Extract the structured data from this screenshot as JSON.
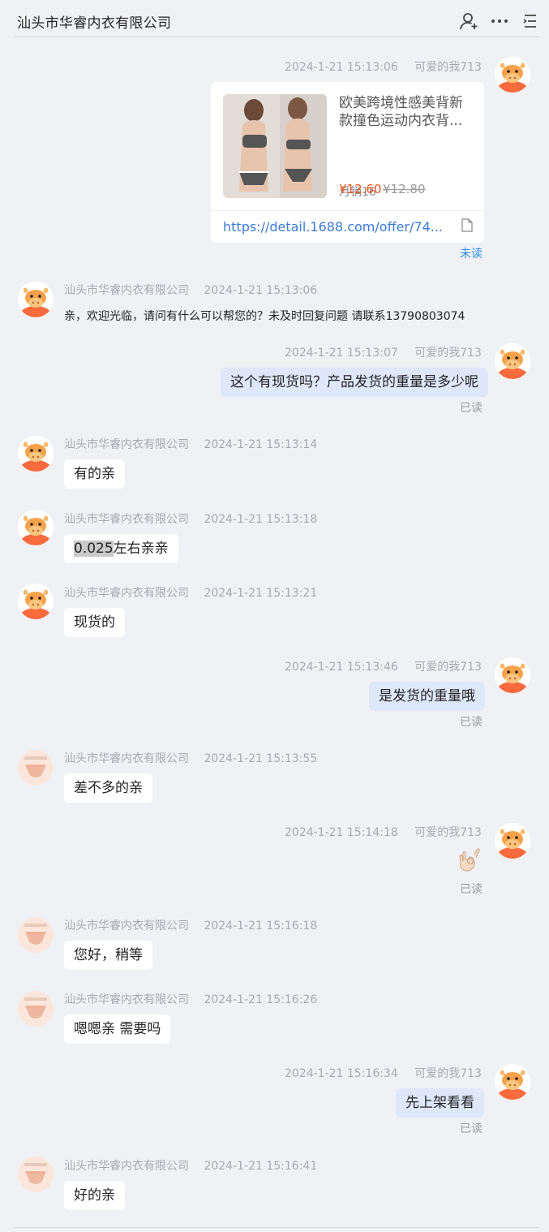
{
  "header": {
    "title": "汕头市华睿内衣有限公司",
    "icons": [
      "add-contact-icon",
      "more-icon",
      "menu-icon"
    ]
  },
  "messages": [
    {
      "side": "right",
      "sender": "可爱的我713",
      "time": "2024-1-21 15:13:06",
      "type": "product-card",
      "product": {
        "title": "欧美跨境性感美背新款撞色运动内衣背...",
        "sales": "月销16",
        "price": "¥12.60",
        "old_price": "¥12.80",
        "link": "https://detail.1688.com/offer/74..."
      },
      "status": "未读"
    },
    {
      "side": "left",
      "sender": "汕头市华睿内衣有限公司",
      "time": "2024-1-21 15:13:06",
      "text": "亲，欢迎光临，请问有什么可以帮您的？未及时回复问题 请联系13790803074"
    },
    {
      "side": "right",
      "sender": "可爱的我713",
      "time": "2024-1-21 15:13:07",
      "text": "这个有现货吗？产品发货的重量是多少呢",
      "status": "已读"
    },
    {
      "side": "left",
      "sender": "汕头市华睿内衣有限公司",
      "time": "2024-1-21 15:13:14",
      "text": "有的亲"
    },
    {
      "side": "left",
      "sender": "汕头市华睿内衣有限公司",
      "time": "2024-1-21 15:13:18",
      "text_highlight": "0.025",
      "text": "左右亲亲"
    },
    {
      "side": "left",
      "sender": "汕头市华睿内衣有限公司",
      "time": "2024-1-21 15:13:21",
      "text": "现货的"
    },
    {
      "side": "right",
      "sender": "可爱的我713",
      "time": "2024-1-21 15:13:46",
      "text": "是发货的重量哦",
      "status": "已读"
    },
    {
      "side": "left",
      "sender": "汕头市华睿内衣有限公司",
      "time": "2024-1-21 15:13:55",
      "text": "差不多的亲"
    },
    {
      "side": "right",
      "sender": "可爱的我713",
      "time": "2024-1-21 15:14:18",
      "type": "emoji",
      "emoji": "👌🏻",
      "status": "已读"
    },
    {
      "side": "left",
      "sender": "汕头市华睿内衣有限公司",
      "time": "2024-1-21 15:16:18",
      "text": "您好，稍等"
    },
    {
      "side": "left",
      "sender": "汕头市华睿内衣有限公司",
      "time": "2024-1-21 15:16:26",
      "text": "嗯嗯亲 需要吗"
    },
    {
      "side": "right",
      "sender": "可爱的我713",
      "time": "2024-1-21 15:16:34",
      "text": "先上架看看",
      "status": "已读"
    },
    {
      "side": "left",
      "sender": "汕头市华睿内衣有限公司",
      "time": "2024-1-21 15:16:41",
      "text": "好的亲"
    }
  ]
}
